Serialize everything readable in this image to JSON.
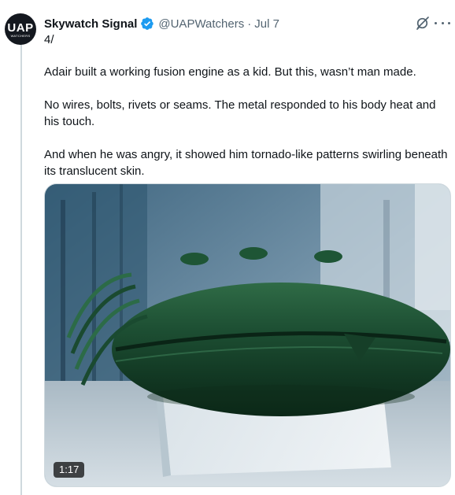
{
  "author": {
    "avatar_text": "UAP",
    "avatar_subtext": "WATCHERS",
    "display_name": "Skywatch Signal",
    "handle": "@UAPWatchers",
    "separator": "·",
    "date": "Jul 7",
    "verified_icon": "verified-badge-icon"
  },
  "tweet": {
    "thread_marker": "4/",
    "paragraphs": [
      "Adair built a working fusion engine as a kid. But this, wasn’t man made.",
      "No wires, bolts, rivets or seams. The metal responded to his body heat and his touch.",
      "And when he was angry, it showed him tornado-like patterns swirling beneath its translucent skin."
    ]
  },
  "media": {
    "type": "video",
    "duration": "1:17",
    "subject": "green-metallic-capsule"
  },
  "actions": {
    "grok_icon": "grok-icon",
    "more_icon": "more-options-icon"
  },
  "colors": {
    "text_primary": "#0f1419",
    "text_secondary": "#536471",
    "verified_blue": "#1d9bf0",
    "border": "#cfd9de"
  }
}
